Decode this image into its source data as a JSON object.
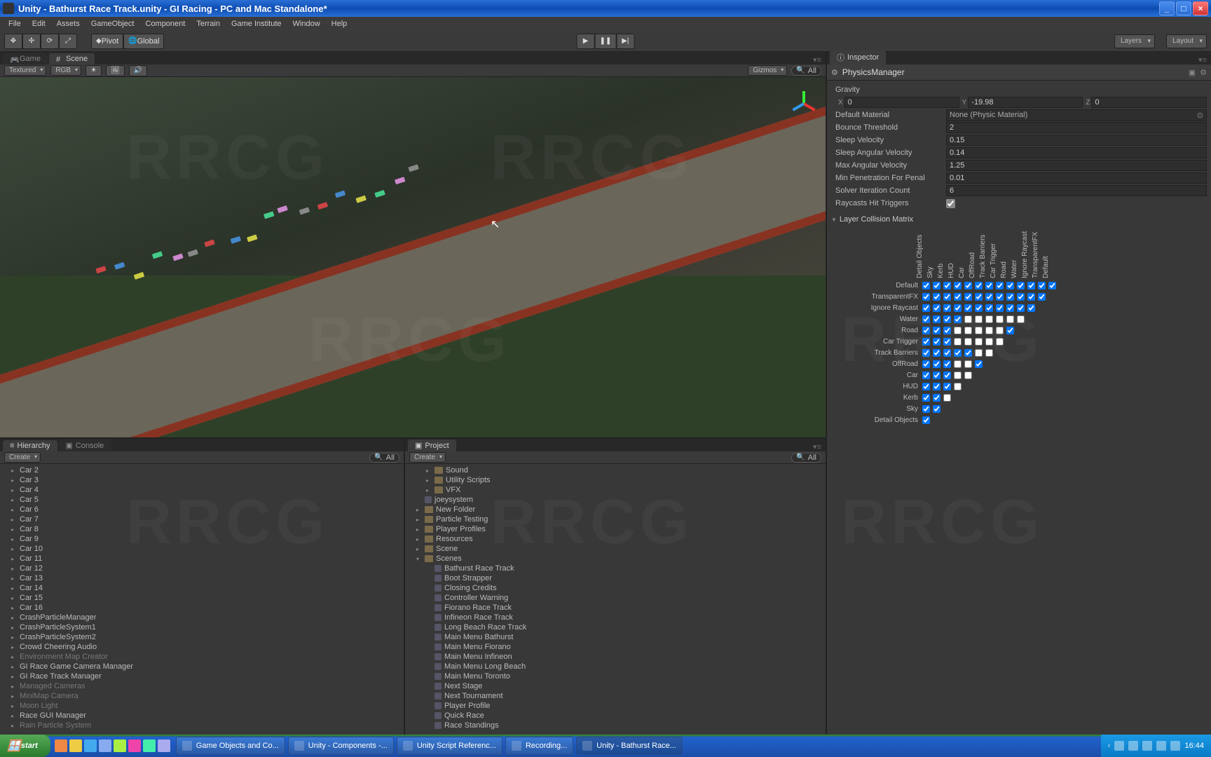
{
  "window": {
    "title": "Unity - Bathurst Race Track.unity - GI Racing - PC and Mac Standalone*"
  },
  "menu": [
    "File",
    "Edit",
    "Assets",
    "GameObject",
    "Component",
    "Terrain",
    "Game Institute",
    "Window",
    "Help"
  ],
  "toolbar": {
    "pivot": "Pivot",
    "global": "Global",
    "layers": "Layers",
    "layout": "Layout"
  },
  "tabs": {
    "game": "Game",
    "scene": "Scene",
    "hierarchy": "Hierarchy",
    "console": "Console",
    "project": "Project",
    "inspector": "Inspector"
  },
  "scenebar": {
    "drawmode": "Textured",
    "rendermode": "RGB",
    "gizmos": "Gizmos",
    "search": "All"
  },
  "hier": {
    "create": "Create",
    "search": "All",
    "items": [
      {
        "t": "Car 2"
      },
      {
        "t": "Car 3"
      },
      {
        "t": "Car 4"
      },
      {
        "t": "Car 5"
      },
      {
        "t": "Car 6"
      },
      {
        "t": "Car 7"
      },
      {
        "t": "Car 8"
      },
      {
        "t": "Car 9"
      },
      {
        "t": "Car 10"
      },
      {
        "t": "Car 11"
      },
      {
        "t": "Car 12"
      },
      {
        "t": "Car 13"
      },
      {
        "t": "Car 14"
      },
      {
        "t": "Car 15"
      },
      {
        "t": "Car 16"
      },
      {
        "t": "CrashParticleManager"
      },
      {
        "t": "CrashParticleSystem1"
      },
      {
        "t": "CrashParticleSystem2"
      },
      {
        "t": "Crowd Cheering Audio"
      },
      {
        "t": "Environment Map Creator",
        "dim": true
      },
      {
        "t": "GI Race Game Camera Manager"
      },
      {
        "t": "GI Race Track Manager"
      },
      {
        "t": "Managed Cameras",
        "dim": true
      },
      {
        "t": "MiniMap Camera",
        "dim": true
      },
      {
        "t": "Moon Light",
        "dim": true
      },
      {
        "t": "Race GUI Manager"
      },
      {
        "t": "Rain Particle System",
        "dim": true
      }
    ]
  },
  "proj": {
    "create": "Create",
    "search": "All",
    "items": [
      {
        "t": "Sound",
        "k": "f",
        "i": 1
      },
      {
        "t": "Utility Scripts",
        "k": "f",
        "i": 1
      },
      {
        "t": "VFX",
        "k": "f",
        "i": 1
      },
      {
        "t": "joeysystem",
        "k": "s",
        "i": 0
      },
      {
        "t": "New Folder",
        "k": "f",
        "i": 0
      },
      {
        "t": "Particle Testing",
        "k": "f",
        "i": 0
      },
      {
        "t": "Player Profiles",
        "k": "f",
        "i": 0
      },
      {
        "t": "Resources",
        "k": "f",
        "i": 0
      },
      {
        "t": "Scene",
        "k": "f",
        "i": 0
      },
      {
        "t": "Scenes",
        "k": "f",
        "i": 0,
        "open": true
      },
      {
        "t": "Bathurst Race Track",
        "k": "s",
        "i": 1
      },
      {
        "t": "Boot Strapper",
        "k": "s",
        "i": 1
      },
      {
        "t": "Closing Credits",
        "k": "s",
        "i": 1
      },
      {
        "t": "Controller Warning",
        "k": "s",
        "i": 1
      },
      {
        "t": "Fiorano Race Track",
        "k": "s",
        "i": 1
      },
      {
        "t": "Infineon Race Track",
        "k": "s",
        "i": 1
      },
      {
        "t": "Long Beach Race Track",
        "k": "s",
        "i": 1
      },
      {
        "t": "Main Menu Bathurst",
        "k": "s",
        "i": 1
      },
      {
        "t": "Main Menu Fiorano",
        "k": "s",
        "i": 1
      },
      {
        "t": "Main Menu Infineon",
        "k": "s",
        "i": 1
      },
      {
        "t": "Main Menu Long Beach",
        "k": "s",
        "i": 1
      },
      {
        "t": "Main Menu Toronto",
        "k": "s",
        "i": 1
      },
      {
        "t": "Next Stage",
        "k": "s",
        "i": 1
      },
      {
        "t": "Next Tournament",
        "k": "s",
        "i": 1
      },
      {
        "t": "Player Profile",
        "k": "s",
        "i": 1
      },
      {
        "t": "Quick Race",
        "k": "s",
        "i": 1
      },
      {
        "t": "Race Standings",
        "k": "s",
        "i": 1
      }
    ]
  },
  "inspector": {
    "component": "PhysicsManager",
    "gravity_label": "Gravity",
    "gravity": {
      "x": "0",
      "y": "-19.98",
      "z": "0"
    },
    "props": [
      {
        "l": "Default Material",
        "v": "None (Physic Material)",
        "obj": true
      },
      {
        "l": "Bounce Threshold",
        "v": "2"
      },
      {
        "l": "Sleep Velocity",
        "v": "0.15"
      },
      {
        "l": "Sleep Angular Velocity",
        "v": "0.14"
      },
      {
        "l": "Max Angular Velocity",
        "v": "1.25"
      },
      {
        "l": "Min Penetration For Penal",
        "v": "0.01"
      },
      {
        "l": "Solver Iteration Count",
        "v": "6"
      },
      {
        "l": "Raycasts Hit Triggers",
        "cb": true,
        "v": true
      }
    ],
    "matrix_label": "Layer Collision Matrix",
    "layers": [
      "Default",
      "TransparentFX",
      "Ignore Raycast",
      "Water",
      "Road",
      "Car Trigger",
      "Track Barriers",
      "OffRoad",
      "Car",
      "HUD",
      "Kerb",
      "Sky",
      "Detail Objects"
    ],
    "matrix": [
      [
        1,
        1,
        1,
        1,
        1,
        1,
        1,
        1,
        1,
        1,
        1,
        1,
        1
      ],
      [
        1,
        1,
        1,
        1,
        1,
        1,
        1,
        1,
        1,
        1,
        1,
        1
      ],
      [
        1,
        1,
        1,
        1,
        1,
        1,
        1,
        1,
        1,
        1,
        1
      ],
      [
        1,
        1,
        1,
        1,
        0,
        0,
        0,
        0,
        0,
        0
      ],
      [
        1,
        1,
        1,
        0,
        0,
        0,
        0,
        0,
        1
      ],
      [
        1,
        1,
        1,
        0,
        0,
        0,
        0,
        0
      ],
      [
        1,
        1,
        1,
        1,
        1,
        0,
        0
      ],
      [
        1,
        1,
        1,
        0,
        0,
        1
      ],
      [
        1,
        1,
        1,
        0,
        0
      ],
      [
        1,
        1,
        1,
        0
      ],
      [
        1,
        1,
        0
      ],
      [
        1,
        1
      ],
      [
        1
      ]
    ]
  },
  "taskbar": {
    "start": "start",
    "items": [
      {
        "t": "Game Objects and Co..."
      },
      {
        "t": "Unity - Components -..."
      },
      {
        "t": "Unity Script Referenc..."
      },
      {
        "t": "Recording..."
      },
      {
        "t": "Unity - Bathurst Race...",
        "active": true
      }
    ],
    "clock": "16:44"
  },
  "watermark": "RRCG"
}
